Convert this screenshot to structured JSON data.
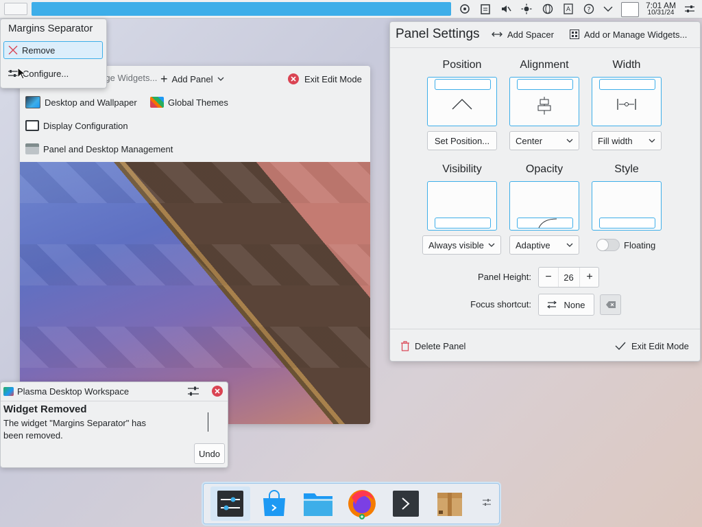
{
  "top_panel": {
    "tray_icons": [
      "network-share-icon",
      "clipboard-icon",
      "volume-muted-icon",
      "brightness-icon",
      "globe-icon",
      "text-icon",
      "help-icon",
      "chevron-down-icon"
    ],
    "time": "7:01 AM",
    "date": "10/31/24"
  },
  "widget_menu": {
    "title": "Margins Separator",
    "items": [
      {
        "label": "Remove",
        "icon": "close-icon"
      },
      {
        "label": "Configure...",
        "icon": "sliders-icon"
      }
    ]
  },
  "edit_toolbar": {
    "manage_widgets": "Add or Manage Widgets...",
    "add_panel": "Add Panel",
    "exit_edit_mode": "Exit Edit Mode"
  },
  "edit_menu": {
    "items": [
      {
        "label": "Desktop and Wallpaper"
      },
      {
        "label": "Global Themes"
      },
      {
        "label": "Display Configuration"
      },
      {
        "label": "Panel and Desktop Management"
      }
    ]
  },
  "panel_settings": {
    "title": "Panel Settings",
    "add_spacer": "Add Spacer",
    "add_widgets": "Add or Manage Widgets...",
    "position_label": "Position",
    "alignment_label": "Alignment",
    "width_label": "Width",
    "position_value": "Set Position...",
    "alignment_value": "Center",
    "width_value": "Fill width",
    "visibility_label": "Visibility",
    "opacity_label": "Opacity",
    "style_label": "Style",
    "visibility_value": "Always visible",
    "opacity_value": "Adaptive",
    "floating_label": "Floating",
    "floating_on": false,
    "height_label": "Panel Height:",
    "height_value": "26",
    "shortcut_label": "Focus shortcut:",
    "shortcut_value": "None",
    "delete_panel": "Delete Panel",
    "exit_edit_mode": "Exit Edit Mode"
  },
  "notification": {
    "app": "Plasma Desktop Workspace",
    "title": "Widget Removed",
    "body": "The widget \"Margins Separator\" has been removed.",
    "undo": "Undo"
  },
  "dock": {
    "apps": [
      "system-settings-icon",
      "discover-icon",
      "dolphin-icon",
      "firefox-icon",
      "konsole-icon",
      "ark-icon"
    ]
  },
  "colors": {
    "accent": "#3daee9",
    "close_red": "#da4453"
  }
}
